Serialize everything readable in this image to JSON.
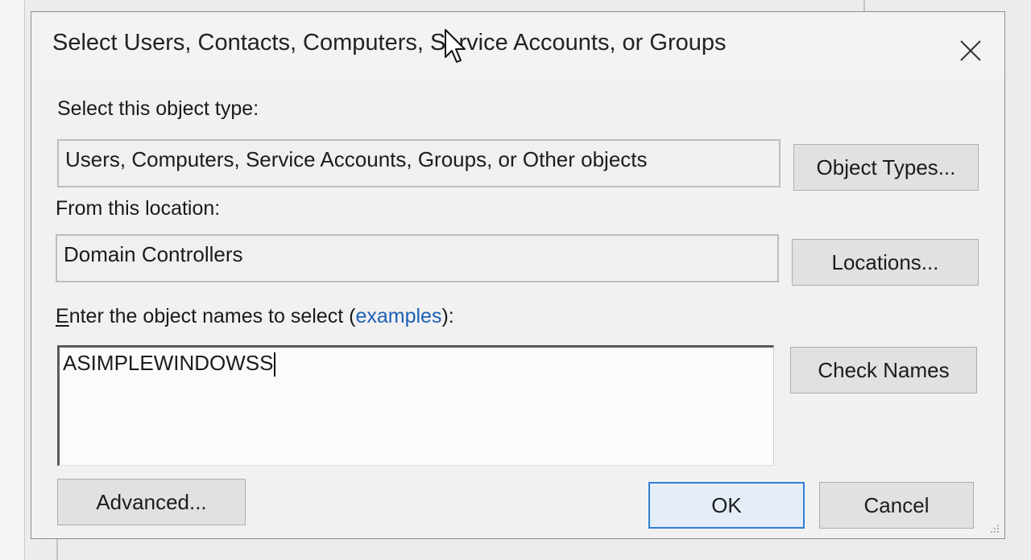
{
  "dialog": {
    "title": "Select Users, Contacts, Computers, Service Accounts, or Groups",
    "close_icon": "close-icon"
  },
  "object_type": {
    "label": "Select this object type:",
    "value": "Users, Computers, Service Accounts, Groups, or Other objects",
    "button_label": "Object Types..."
  },
  "location": {
    "label": "From this location:",
    "value": "Domain Controllers",
    "button_label": "Locations..."
  },
  "names": {
    "label_prefix_underlined": "E",
    "label_prefix_rest": "nter the object names to select (",
    "label_link": "examples",
    "label_suffix": "):",
    "value": "ASIMPLEWINDOWSS",
    "button_label": "Check Names"
  },
  "footer": {
    "advanced_label": "Advanced...",
    "ok_label": "OK",
    "cancel_label": "Cancel"
  },
  "colors": {
    "link": "#1a5fb4",
    "default_button_border": "#2f7fd6",
    "dialog_bg": "#f1f1f1"
  }
}
